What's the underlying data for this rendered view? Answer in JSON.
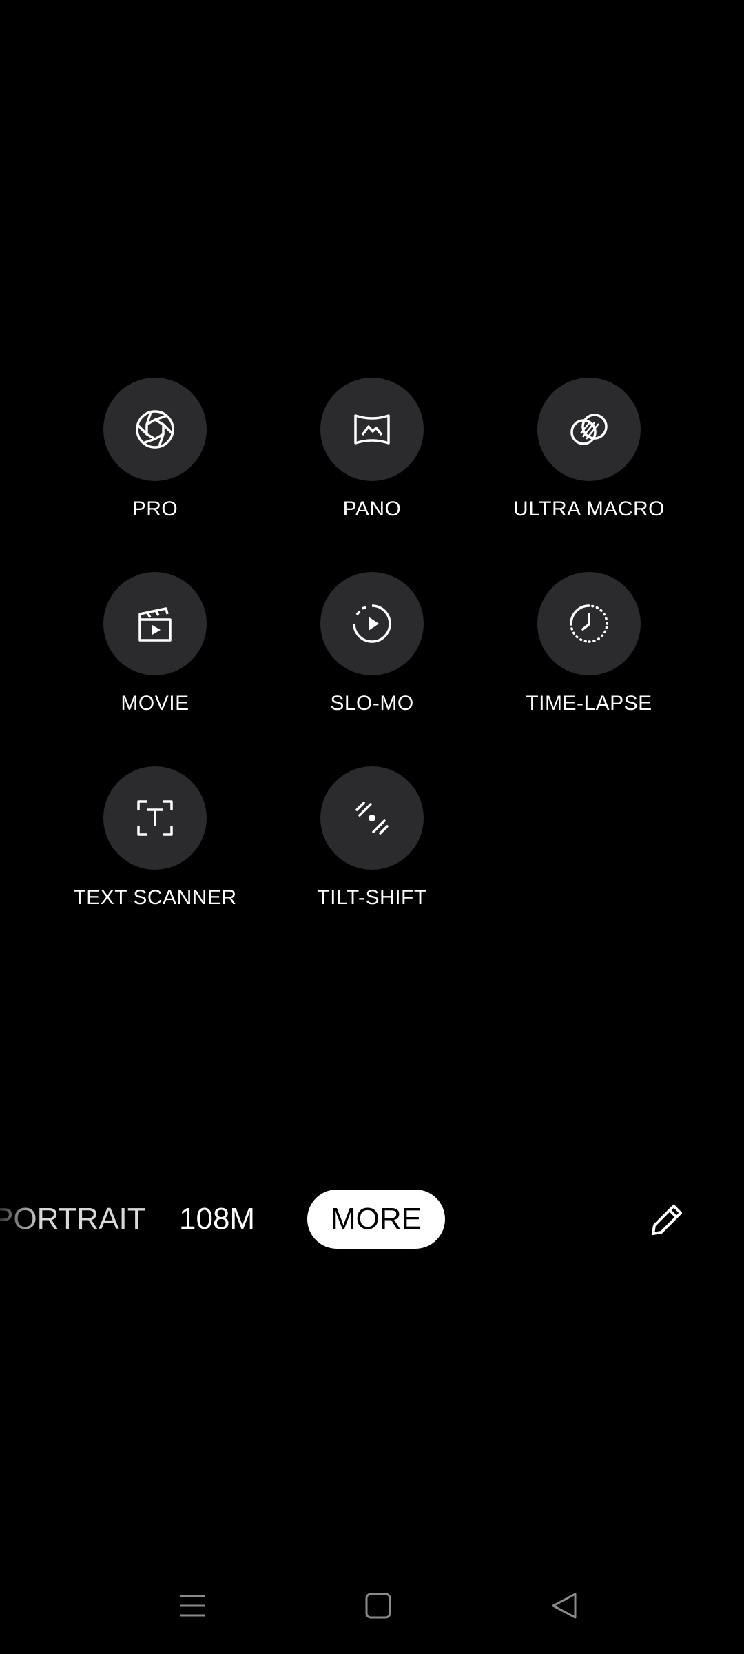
{
  "modes": [
    {
      "label": "PRO",
      "icon": "aperture-icon"
    },
    {
      "label": "PANO",
      "icon": "panorama-icon"
    },
    {
      "label": "ULTRA MACRO",
      "icon": "ultra-macro-icon"
    },
    {
      "label": "MOVIE",
      "icon": "clapperboard-icon"
    },
    {
      "label": "SLO-MO",
      "icon": "slow-motion-icon"
    },
    {
      "label": "TIME-LAPSE",
      "icon": "time-lapse-icon"
    },
    {
      "label": "TEXT SCANNER",
      "icon": "text-scanner-icon"
    },
    {
      "label": "TILT-SHIFT",
      "icon": "tilt-shift-icon"
    }
  ],
  "mode_bar": {
    "portrait": "PORTRAIT",
    "megapixel": "108M",
    "more": "MORE",
    "edit_icon": "pencil-icon"
  },
  "nav_bar": {
    "menu_icon": "menu-icon",
    "home_icon": "home-icon",
    "back_icon": "back-icon"
  },
  "colors": {
    "background": "#000000",
    "circle": "#2b2a2c",
    "text": "#ffffff",
    "active_pill": "#ffffff",
    "nav_icon": "#8a8a8a"
  }
}
